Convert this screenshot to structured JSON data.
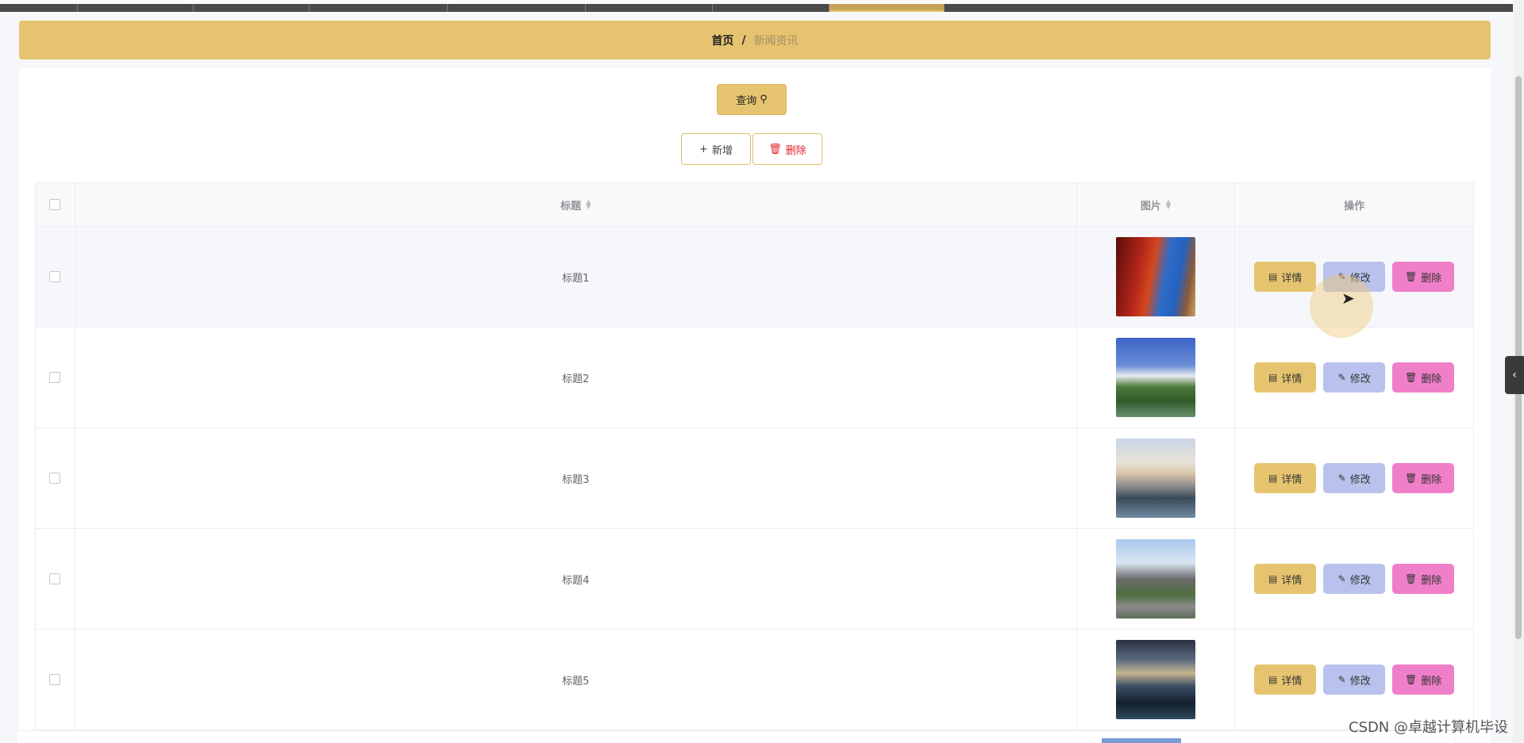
{
  "breadcrumb": {
    "home": "首页",
    "separator": "/",
    "current": "新闻资讯"
  },
  "toolbar": {
    "search_label": "查询",
    "add_label": "新增",
    "delete_label": "删除"
  },
  "table": {
    "headers": {
      "title": "标题",
      "image": "图片",
      "actions": "操作"
    },
    "rows": [
      {
        "title": "标题1"
      },
      {
        "title": "标题2"
      },
      {
        "title": "标题3"
      },
      {
        "title": "标题4"
      },
      {
        "title": "标题5"
      }
    ],
    "row_actions": {
      "detail": "详情",
      "edit": "修改",
      "delete": "删除"
    }
  },
  "colors": {
    "accent": "#e6c46f",
    "edit": "#b8c2ec",
    "delete": "#f07fc9",
    "danger_text": "#e0202a"
  },
  "icons": {
    "search": "search-icon",
    "add": "plus-icon",
    "delete": "trash-icon",
    "detail": "document-icon",
    "edit": "pencil-icon"
  },
  "watermark": "CSDN @卓越计算机毕设"
}
